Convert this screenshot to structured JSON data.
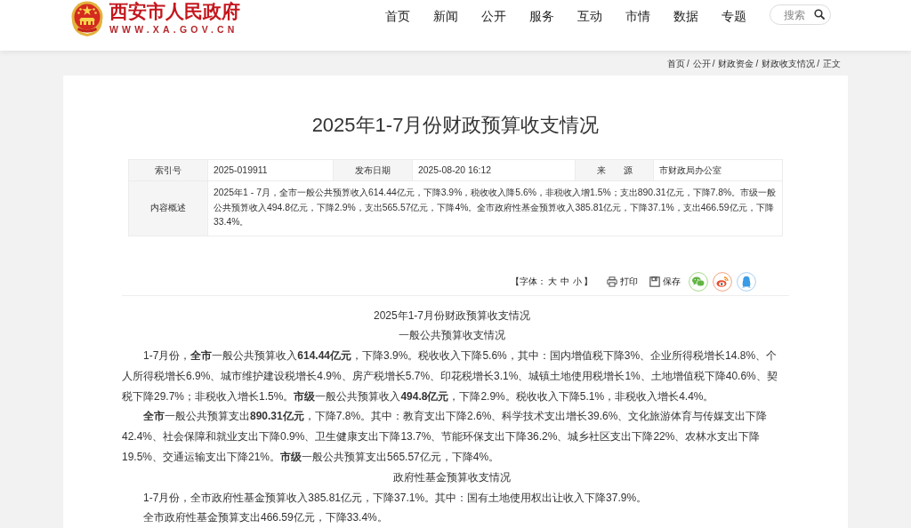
{
  "header": {
    "logo": {
      "title": "西安市人民政府",
      "domain": "WWW.XA.GOV.CN"
    },
    "nav": [
      {
        "label": "首页",
        "selected": false
      },
      {
        "label": "新闻",
        "selected": false
      },
      {
        "label": "公开",
        "selected": false
      },
      {
        "label": "服务",
        "selected": false
      },
      {
        "label": "互动",
        "selected": false
      },
      {
        "label": "市情",
        "selected": false
      },
      {
        "label": "数据",
        "selected": false
      },
      {
        "label": "专题",
        "selected": false
      }
    ],
    "search": {
      "placeholder": "搜索"
    }
  },
  "breadcrumb": {
    "separator": "/",
    "items": [
      "首页",
      "公开",
      "财政资金",
      "财政收支情况",
      "正文"
    ]
  },
  "article": {
    "title": "2025年1-7月份财政预算收支情况",
    "meta": [
      {
        "kind": "short",
        "label": "索引号",
        "value": "2025-019911"
      },
      {
        "kind": "short",
        "label": "发布日期",
        "value": "2025-08-20 16:12"
      },
      {
        "kind": "short",
        "label": "来　　源",
        "value": "市财政局办公室"
      },
      {
        "kind": "summary",
        "label": "内容概述",
        "value": "2025年1 - 7月，全市一般公共预算收入614.44亿元，下降3.9%，税收收入降5.6%，非税收入增1.5%；支出890.31亿元，下降7.8%。市级一般公共预算收入494.8亿元，下降2.9%，支出565.57亿元，下降4%。全市政府性基金预算收入385.81亿元，下降37.1%，支出466.59亿元，下降33.4%。"
      }
    ],
    "tools": {
      "font_size": {
        "prefix": "【字体：",
        "options": [
          "大",
          "中",
          "小"
        ],
        "suffix": "】"
      },
      "actions": [
        {
          "kind": "print",
          "label": "打印"
        },
        {
          "kind": "save",
          "label": "保存"
        }
      ],
      "share": [
        {
          "kind": "wechat"
        },
        {
          "kind": "weibo"
        },
        {
          "kind": "qq"
        }
      ]
    },
    "body": [
      {
        "kind": "heading",
        "text": "2025年1-7月份财政预算收支情况"
      },
      {
        "kind": "heading",
        "text": "一般公共预算收支情况"
      },
      {
        "kind": "paragraph",
        "text": "1-7月份，**全市**一般公共预算收入**614.44亿元**，下降3.9%。税收收入下降5.6%，其中：国内增值税下降3%、企业所得税增长14.8%、个人所得税增长6.9%、城市维护建设税增长4.9%、房产税增长5.7%、印花税增长3.1%、城镇土地使用税增长1%、土地增值税下降40.6%、契税下降29.7%；非税收入增长1.5%。**市级**一般公共预算收入**494.8亿元**，下降2.9%。税收收入下降5.1%，非税收入增长4.4%。"
      },
      {
        "kind": "paragraph",
        "text": "**全市**一般公共预算支出**890.31亿元**，下降7.8%。其中：教育支出下降2.6%、科学技术支出增长39.6%、文化旅游体育与传媒支出下降42.4%、社会保障和就业支出下降0.9%、卫生健康支出下降13.7%、节能环保支出下降36.2%、城乡社区支出下降22%、农林水支出下降19.5%、交通运输支出下降21%。**市级**一般公共预算支出565.57亿元，下降4%。"
      },
      {
        "kind": "heading",
        "text": "政府性基金预算收支情况"
      },
      {
        "kind": "paragraph",
        "text": "1-7月份，全市政府性基金预算收入385.81亿元，下降37.1%。其中：国有土地使用权出让收入下降37.9%。"
      },
      {
        "kind": "paragraph",
        "text": "全市政府性基金预算支出466.59亿元，下降33.4%。"
      }
    ]
  }
}
